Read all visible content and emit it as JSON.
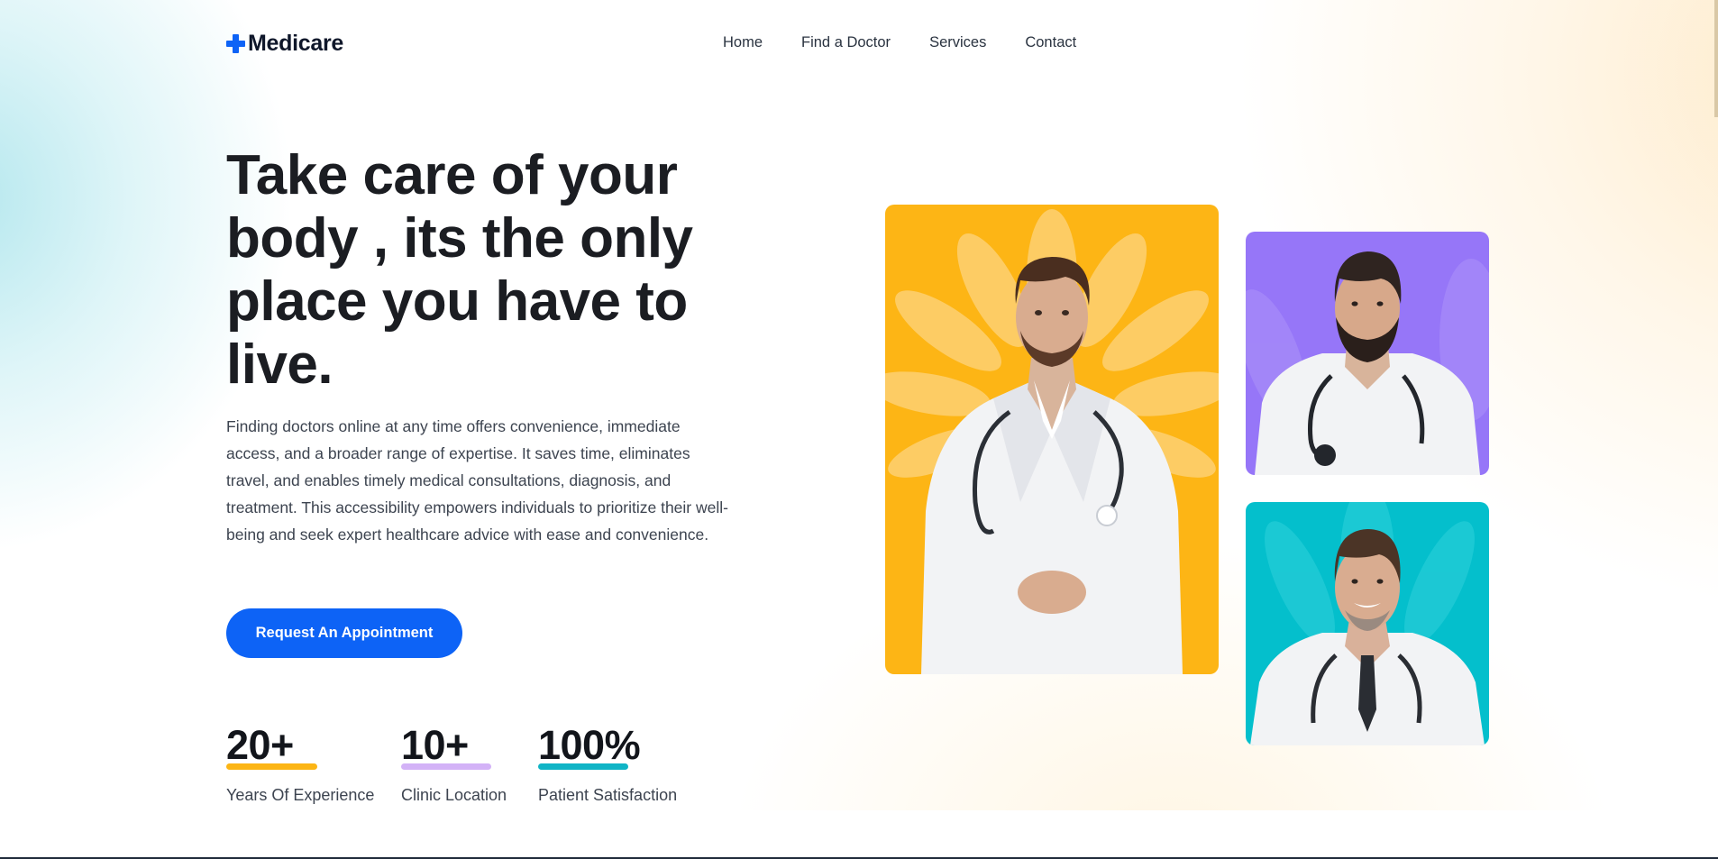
{
  "brand": {
    "name": "Medicare",
    "accent_color": "#0d63f6",
    "icon": "plus-cross-icon"
  },
  "nav": {
    "items": [
      {
        "label": "Home"
      },
      {
        "label": "Find a Doctor"
      },
      {
        "label": "Services"
      },
      {
        "label": "Contact"
      }
    ]
  },
  "hero": {
    "headline_lines": [
      "Take care of your",
      "body , its the only",
      "place you have to",
      "live."
    ],
    "description": "Finding doctors online at any time offers convenience, immediate access, and a broader range of expertise. It saves time, eliminates travel, and enables timely medical consultations, diagnosis, and treatment. This accessibility empowers individuals to prioritize their well-being and seek expert healthcare advice with ease and convenience.",
    "cta_label": "Request An Appointment"
  },
  "stats": [
    {
      "value": "20+",
      "label": "Years Of Experience",
      "underline_color": "#fcb515"
    },
    {
      "value": "10+",
      "label": "Clinic Location",
      "underline_color": "#d3b2f7"
    },
    {
      "value": "100%",
      "label": "Patient Satisfaction",
      "underline_color": "#10b4c6"
    }
  ],
  "doctor_cards": [
    {
      "background": "#fdb515",
      "image": "doctor-photo-main"
    },
    {
      "background": "#9676f8",
      "image": "doctor-photo-bearded"
    },
    {
      "background": "#04bfcc",
      "image": "doctor-photo-smiling"
    }
  ]
}
